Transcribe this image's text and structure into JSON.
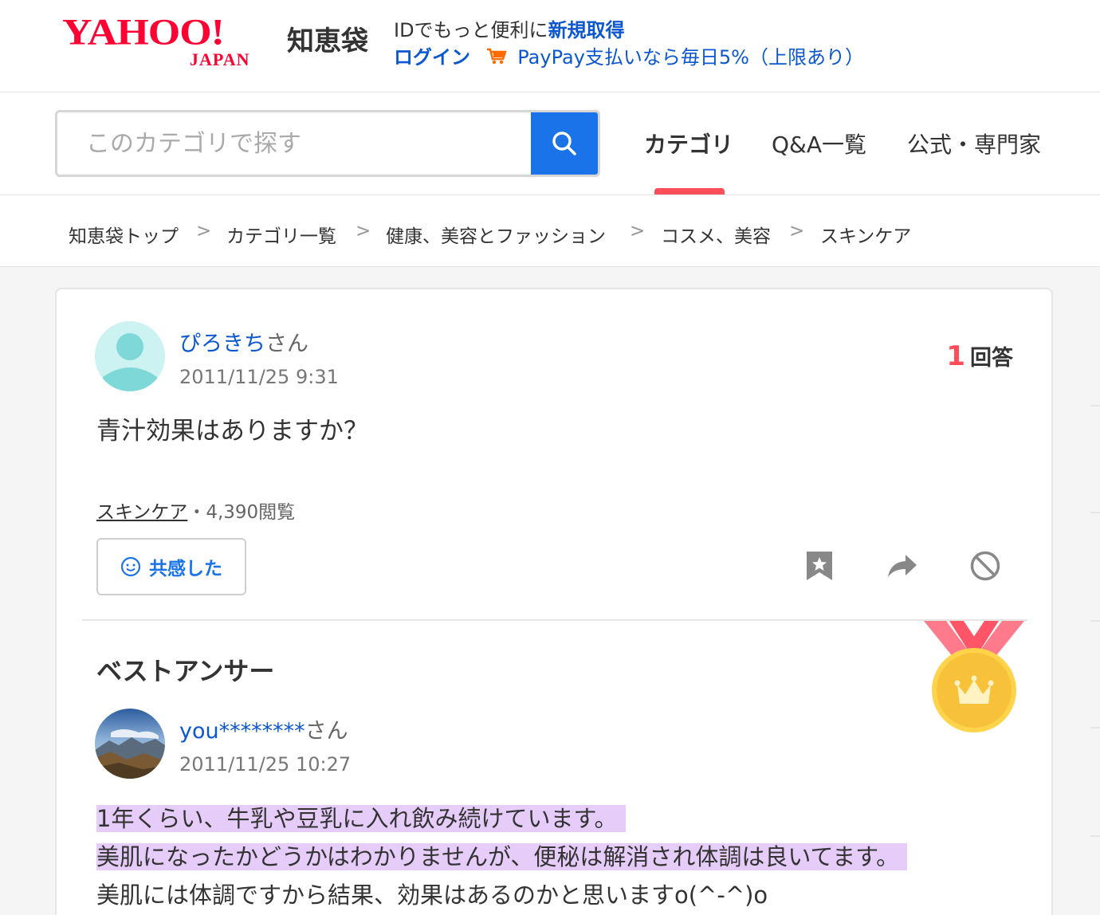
{
  "header": {
    "logo_yahoo": "YAHOO!",
    "logo_japan": "JAPAN",
    "logo_service": "知恵袋",
    "promo_text": "IDでもっと便利に",
    "promo_link": "新規取得",
    "login": "ログイン",
    "paypay": "PayPay支払いなら毎日5%（上限あり）",
    "cart_icon": "shopping-cart-icon"
  },
  "search": {
    "placeholder": "このカテゴリで探す",
    "button_icon": "search-icon"
  },
  "tabs": [
    {
      "label": "カテゴリ",
      "active": true
    },
    {
      "label": "Q&A一覧",
      "active": false
    },
    {
      "label": "公式・専門家",
      "active": false
    }
  ],
  "breadcrumb": {
    "items": [
      "知恵袋トップ",
      "カテゴリ一覧",
      "健康、美容とファッション",
      "コスメ、美容",
      "スキンケア"
    ],
    "separator": ">"
  },
  "question": {
    "user": "ぴろきち",
    "user_suffix": "さん",
    "date": "2011/11/25 9:31",
    "answer_count": "1",
    "answer_label": "回答",
    "text": "青汁効果はありますか？",
    "category": "スキンケア",
    "views": "・4,390閲覧",
    "empathy_label": "共感した"
  },
  "best_answer": {
    "title": "ベストアンサー",
    "user": "you********",
    "user_suffix": "さん",
    "date": "2011/11/25 10:27",
    "lines": [
      "1年くらい、牛乳や豆乳に入れ飲み続けています。",
      "美肌になったかどうかはわかりませんが、便秘は解消され体調は良いてます。",
      "美肌には体調ですから結果、効果はあるのかと思いますo(^-^)o"
    ]
  },
  "colors": {
    "brand_red": "#ff0033",
    "link_blue": "#0b57d0",
    "accent_blue": "#1a73e8",
    "tab_accent": "#ff4d5a",
    "highlight": "#e6ccf9"
  }
}
